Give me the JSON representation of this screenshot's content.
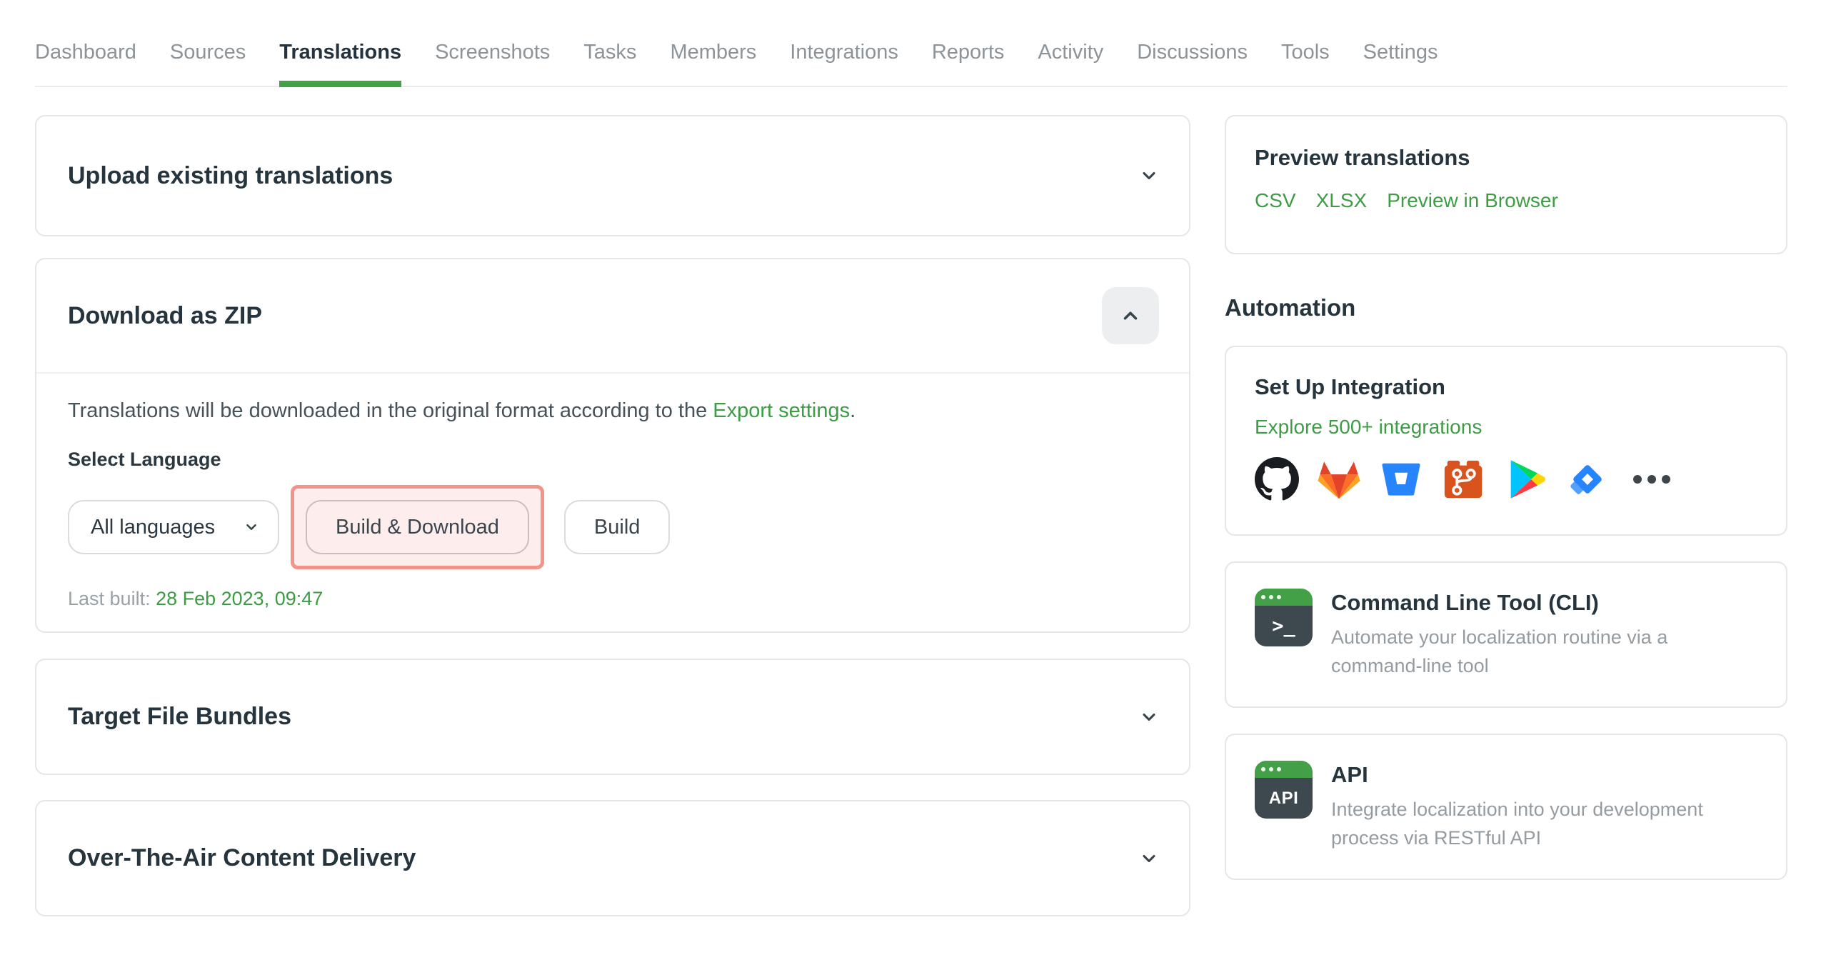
{
  "nav": {
    "tabs": [
      {
        "label": "Dashboard",
        "active": false
      },
      {
        "label": "Sources",
        "active": false
      },
      {
        "label": "Translations",
        "active": true
      },
      {
        "label": "Screenshots",
        "active": false
      },
      {
        "label": "Tasks",
        "active": false
      },
      {
        "label": "Members",
        "active": false
      },
      {
        "label": "Integrations",
        "active": false
      },
      {
        "label": "Reports",
        "active": false
      },
      {
        "label": "Activity",
        "active": false
      },
      {
        "label": "Discussions",
        "active": false
      },
      {
        "label": "Tools",
        "active": false
      },
      {
        "label": "Settings",
        "active": false
      }
    ]
  },
  "left": {
    "upload": {
      "title": "Upload existing translations"
    },
    "download": {
      "title": "Download as ZIP",
      "description_prefix": "Translations will be downloaded in the original format according to the ",
      "description_link": "Export settings",
      "description_suffix": ".",
      "select_language_label": "Select Language",
      "language_value": "All languages",
      "build_download_label": "Build & Download",
      "build_label": "Build",
      "last_built_label": "Last built: ",
      "last_built_value": "28 Feb 2023, 09:47"
    },
    "bundles": {
      "title": "Target File Bundles"
    },
    "ota": {
      "title": "Over-The-Air Content Delivery"
    }
  },
  "right": {
    "preview": {
      "title": "Preview translations",
      "links": [
        "CSV",
        "XLSX",
        "Preview in Browser"
      ]
    },
    "automation_heading": "Automation",
    "integration": {
      "title": "Set Up Integration",
      "link": "Explore 500+ integrations",
      "icons": [
        "github",
        "gitlab",
        "bitbucket",
        "git",
        "google-play",
        "jira",
        "more"
      ]
    },
    "cli": {
      "icon_text": ">_",
      "title": "Command Line Tool (CLI)",
      "description": "Automate your localization routine via a command-line tool"
    },
    "api": {
      "icon_text": "API",
      "title": "API",
      "description": "Integrate localization into your development process via RESTful API"
    }
  },
  "colors": {
    "accent_green": "#43a047",
    "link_green": "#3e9c45",
    "highlight_border": "#f29488",
    "highlight_fill": "#fdedec"
  }
}
